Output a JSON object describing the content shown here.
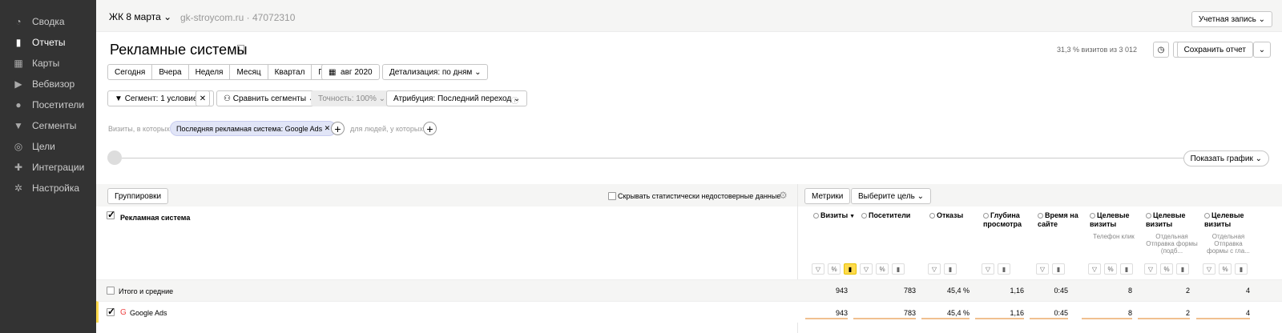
{
  "sidebar": {
    "items": [
      {
        "label": "Сводка",
        "icon": "dashboard-icon",
        "glyph": "◔"
      },
      {
        "label": "Отчеты",
        "icon": "reports-icon",
        "glyph": "▮"
      },
      {
        "label": "Карты",
        "icon": "maps-icon",
        "glyph": "▦"
      },
      {
        "label": "Вебвизор",
        "icon": "play-icon",
        "glyph": "▶"
      },
      {
        "label": "Посетители",
        "icon": "user-icon",
        "glyph": "●"
      },
      {
        "label": "Сегменты",
        "icon": "filter-icon",
        "glyph": "▼"
      },
      {
        "label": "Цели",
        "icon": "target-icon",
        "glyph": "◎"
      },
      {
        "label": "Интеграции",
        "icon": "puzzle-icon",
        "glyph": "✚"
      },
      {
        "label": "Настройка",
        "icon": "gear-icon",
        "glyph": "✲"
      }
    ]
  },
  "topbar": {
    "counter": "ЖК 8 марта",
    "site": "gk-stroycom.ru · 47072310",
    "account": "Учетная запись"
  },
  "header": {
    "title": "Рекламные системы",
    "visits_note": "31,3 % визитов из 3 012",
    "save_report": "Сохранить отчет"
  },
  "periods": [
    "Сегодня",
    "Вчера",
    "Неделя",
    "Месяц",
    "Квартал",
    "Год"
  ],
  "date_range": "авг 2020",
  "detail": "Детализация: по дням",
  "filters": {
    "segment": "Сегмент: 1 условие",
    "compare": "Сравнить сегменты",
    "accuracy": "Точность: 100%",
    "attribution": "Атрибуция: Последний переход"
  },
  "condition": {
    "prefix": "Визиты, в которых",
    "chip": "Последняя рекламная система: Google Ads",
    "suffix": "для людей, у которых"
  },
  "show_chart": "Показать график",
  "toolbar": {
    "groupings": "Группировки",
    "hide_label": "Скрывать статистически недостоверные данные",
    "metrics": "Метрики",
    "goal": "Выберите цель"
  },
  "table": {
    "dimension": "Рекламная система",
    "columns": [
      {
        "title": "Визиты",
        "sub": ""
      },
      {
        "title": "Посетители",
        "sub": ""
      },
      {
        "title": "Отказы",
        "sub": ""
      },
      {
        "title": "Глубина просмотра",
        "sub": ""
      },
      {
        "title": "Время на сайте",
        "sub": ""
      },
      {
        "title": "Целевые визиты",
        "sub": "Телефон клик"
      },
      {
        "title": "Целевые визиты",
        "sub": "Отдельная Отправка формы (подб..."
      },
      {
        "title": "Целевые визиты",
        "sub": "Отдельная Отправка формы с гла..."
      }
    ],
    "rows": [
      {
        "label": "Итого и средние",
        "values": [
          "943",
          "783",
          "45,4 %",
          "1,16",
          "0:45",
          "8",
          "2",
          "4"
        ]
      },
      {
        "label": "Google Ads",
        "values": [
          "943",
          "783",
          "45,4 %",
          "1,16",
          "0:45",
          "8",
          "2",
          "4"
        ]
      }
    ]
  }
}
